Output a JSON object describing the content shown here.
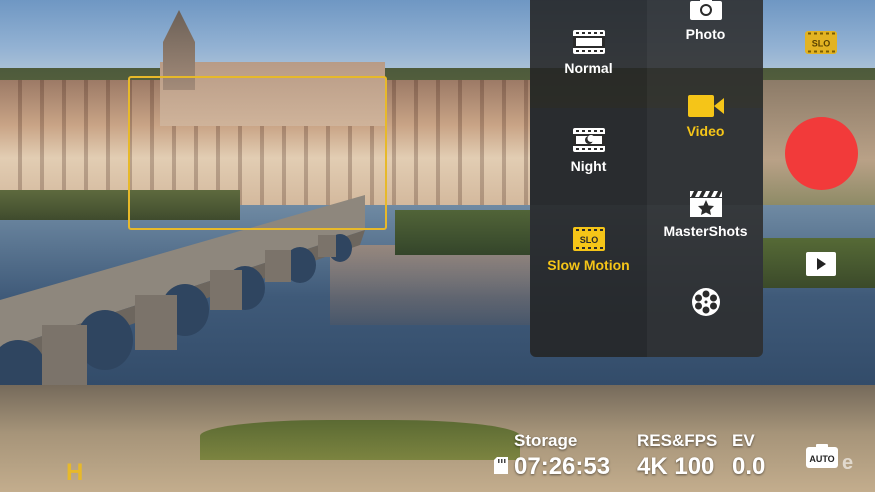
{
  "modes": {
    "normal": "Normal",
    "night": "Night",
    "slow_motion": "Slow Motion",
    "photo": "Photo",
    "video": "Video",
    "mastershots": "MasterShots",
    "active": "video"
  },
  "icons": {
    "normal": "film-strip-icon",
    "night": "film-moon-icon",
    "slow_motion": "slo-film-icon",
    "photo": "camera-icon",
    "video": "video-camera-icon",
    "mastershots": "clapperboard-star-icon",
    "more": "film-reel-icon",
    "slo_badge": "slo-icon",
    "record": "record-button",
    "playback": "play-icon",
    "storage": "sd-card-icon",
    "auto": "auto-camera-icon"
  },
  "badges": {
    "slo_text": "SLO",
    "auto_text": "AUTO",
    "gimbal_mode": "H"
  },
  "status": {
    "storage_label": "Storage",
    "storage_value": "07:26:53",
    "res_fps_label": "RES&FPS",
    "res_fps_value": "4K 100",
    "ev_label": "EV",
    "ev_value": "0.0"
  },
  "colors": {
    "accent": "#f5c518",
    "record": "#f23a3a",
    "menu_bg": "#2b2b2b"
  }
}
